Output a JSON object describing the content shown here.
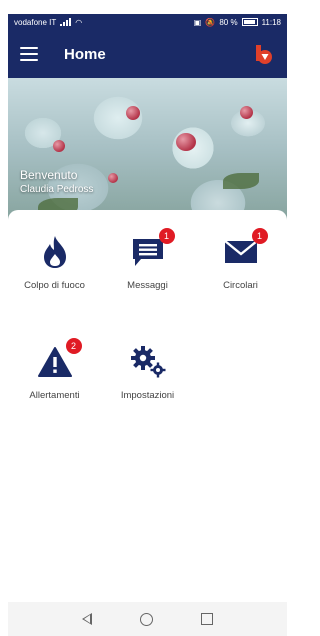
{
  "status_bar": {
    "carrier": "vodafone IT",
    "battery": "80 %",
    "time": "11:18"
  },
  "app_bar": {
    "title": "Home",
    "menu_icon": "hamburger-icon",
    "logo_icon": "app-logo"
  },
  "hero": {
    "greeting": "Benvenuto",
    "user_name": "Claudia Pedross"
  },
  "tiles": [
    {
      "label": "Colpo di fuoco",
      "icon": "flame-icon",
      "badge": ""
    },
    {
      "label": "Messaggi",
      "icon": "message-icon",
      "badge": "1"
    },
    {
      "label": "Circolari",
      "icon": "envelope-icon",
      "badge": "1"
    },
    {
      "label": "Allertamenti",
      "icon": "warning-icon",
      "badge": "2"
    },
    {
      "label": "Impostazioni",
      "icon": "gears-icon",
      "badge": ""
    }
  ],
  "colors": {
    "primary": "#1a2a66",
    "badge": "#e01b24"
  }
}
